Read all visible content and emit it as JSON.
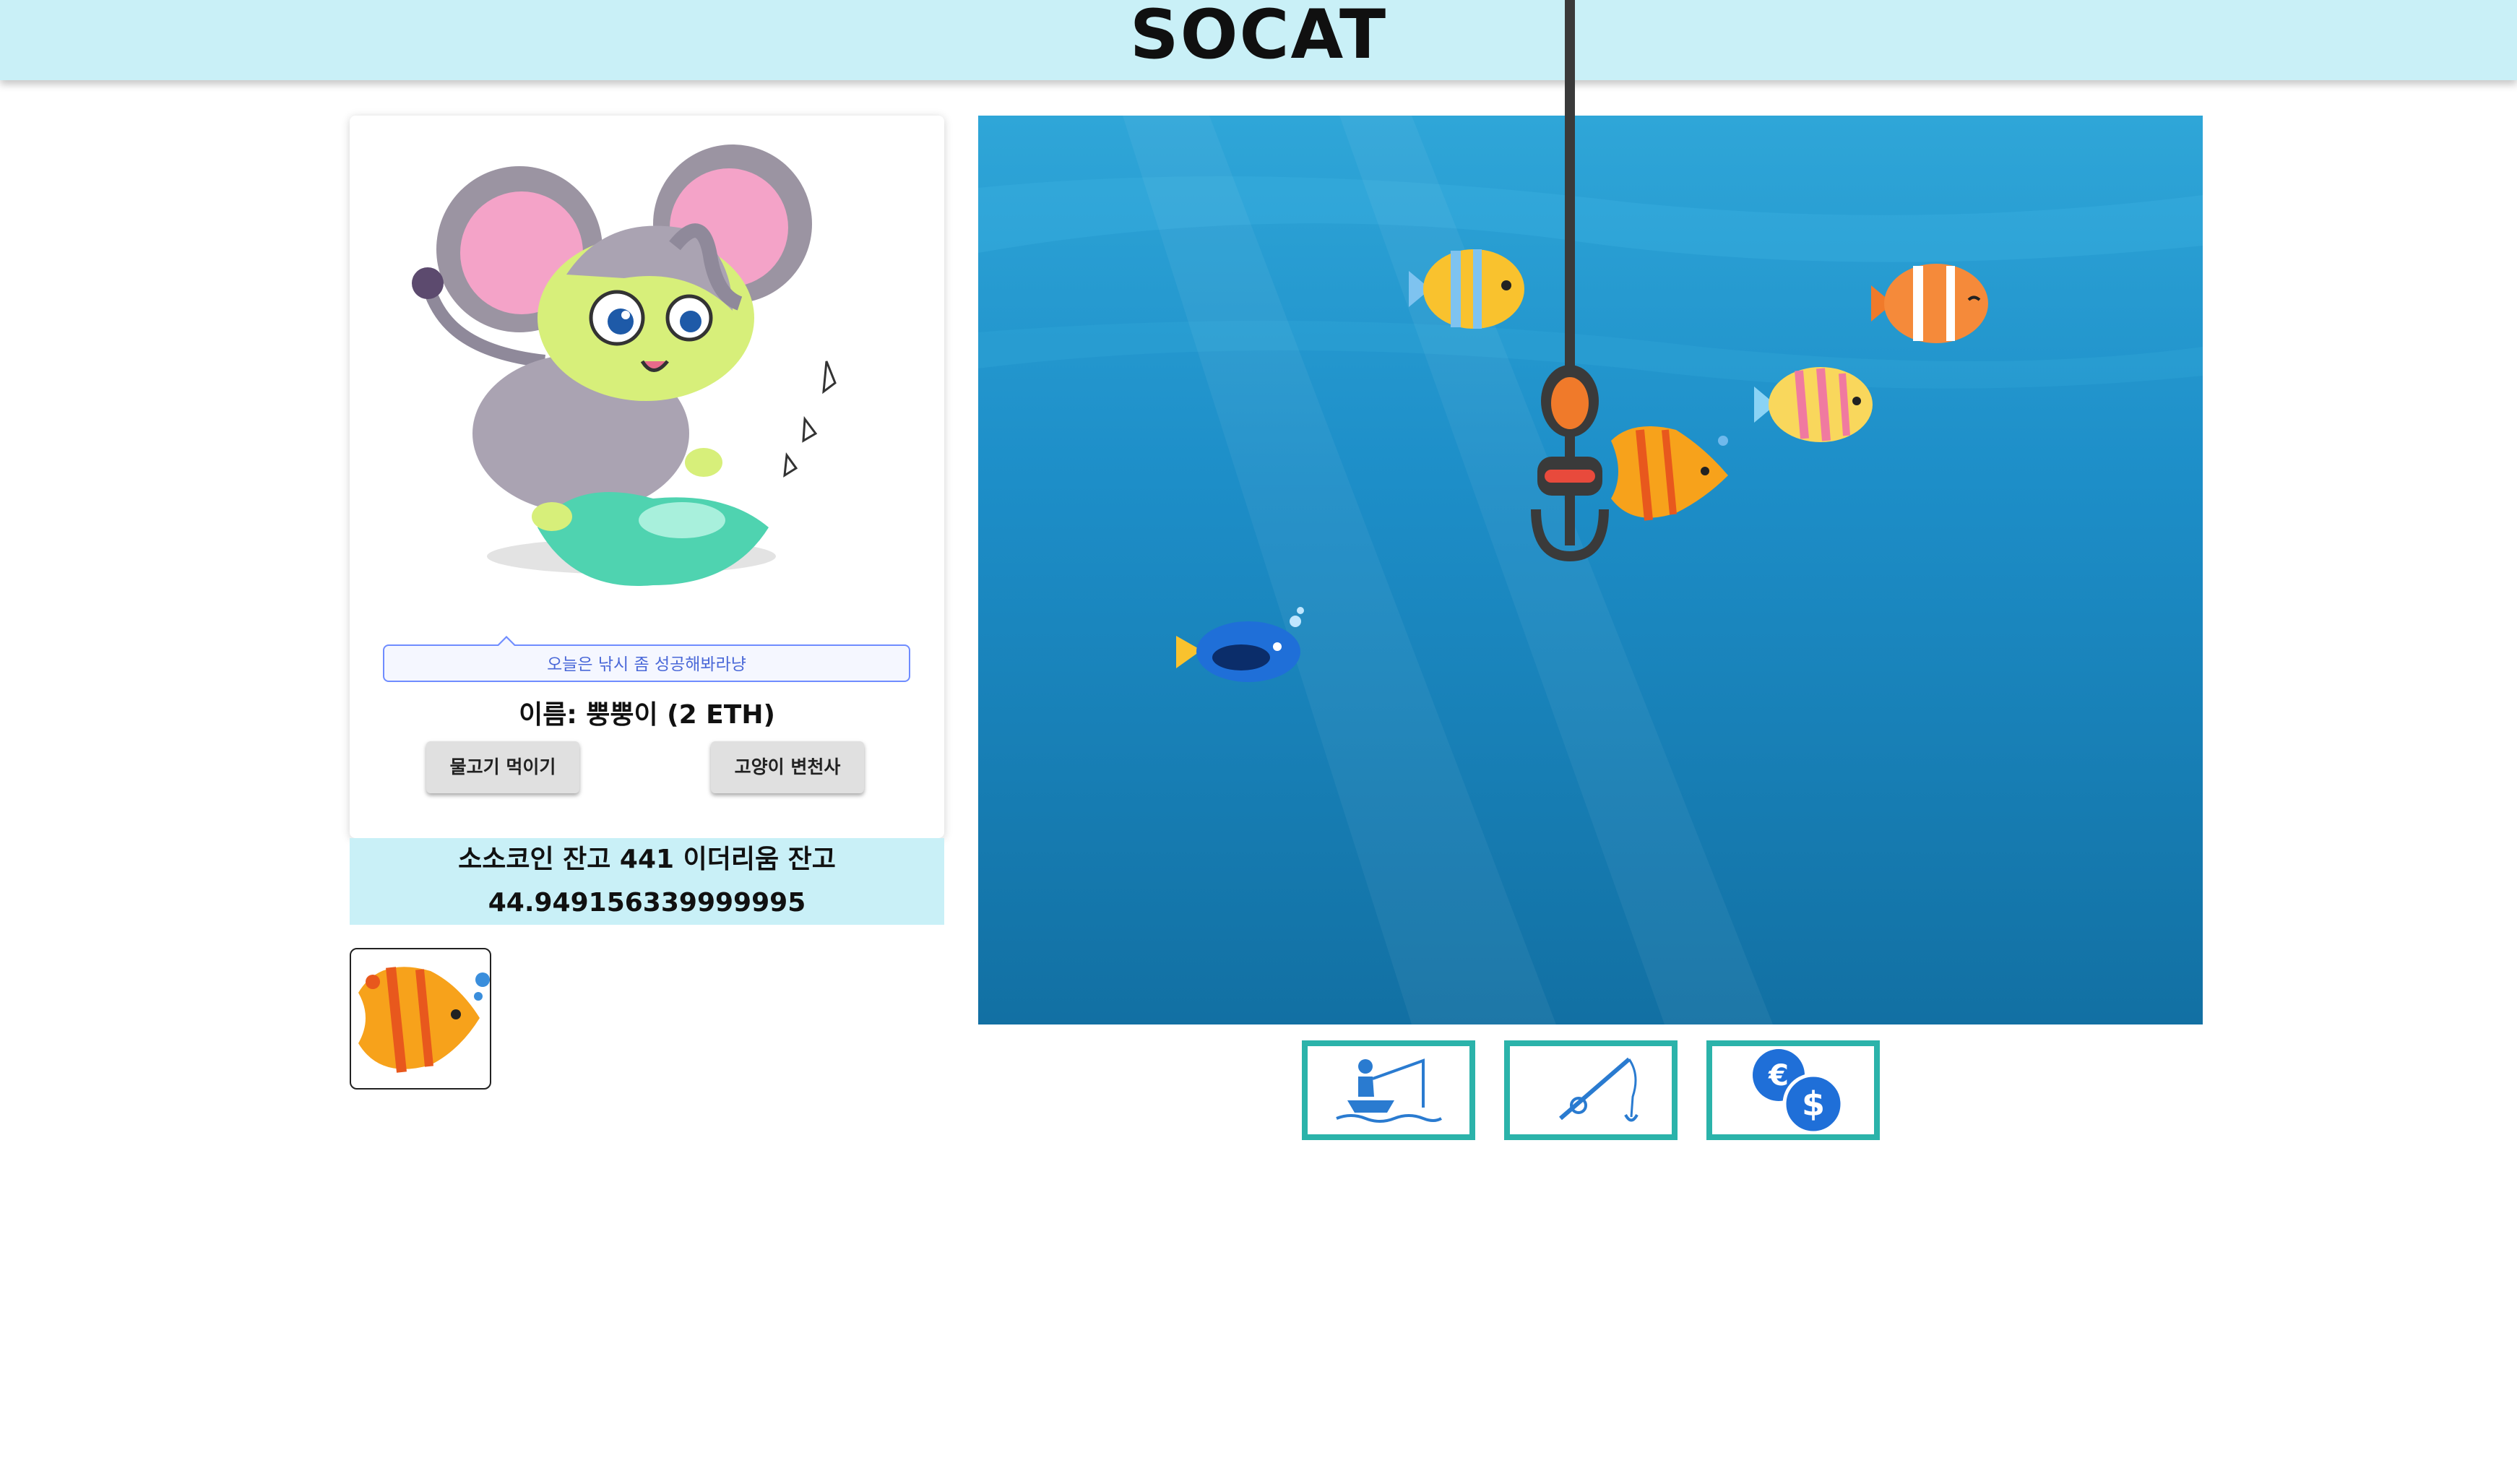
{
  "header": {
    "title": "SOCAT"
  },
  "cat": {
    "speech": "오늘은 낚시 좀 성공해봐라냥",
    "name": "이름: 뿡뿡이 (2 ETH)",
    "feed_button": "물고기 먹이기",
    "change_button": "고양이 변천사"
  },
  "balance": {
    "line1": "소소코인 잔고 441 이더리움 잔고",
    "line2": "44.949156339999995"
  },
  "colors": {
    "header_bg": "#c9f0f7",
    "tool_border": "#2bb3aa",
    "speech_border": "#6f8cff",
    "hook": "#3a3a3a",
    "hook_bobber": "#f07a2a"
  },
  "inventory": [
    {
      "icon": "butterflyfish-icon"
    }
  ],
  "sea_fish": [
    {
      "icon": "striped-yellow-fish-icon"
    },
    {
      "icon": "clownfish-icon"
    },
    {
      "icon": "pink-striped-fish-icon"
    },
    {
      "icon": "butterflyfish-icon"
    },
    {
      "icon": "blue-tang-fish-icon"
    }
  ],
  "tools": [
    {
      "icon": "fisherman-boat-icon"
    },
    {
      "icon": "fishing-rod-icon"
    },
    {
      "icon": "currency-exchange-icon"
    }
  ]
}
